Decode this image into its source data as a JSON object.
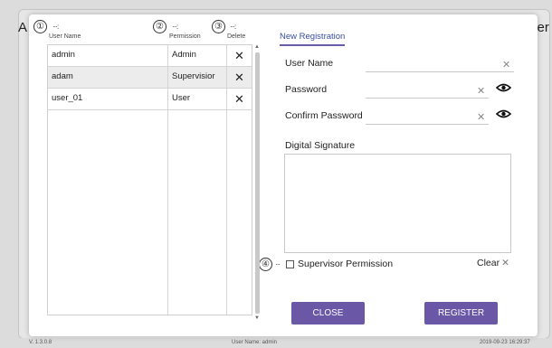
{
  "background": {
    "title_left": "A",
    "title_right": "ser",
    "status": {
      "version": "V. 1.3.0.8",
      "user": "User Name: admin",
      "datetime": "2019-09-23 16:29:37"
    }
  },
  "callouts": [
    {
      "number": "①",
      "dots": "···:"
    },
    {
      "number": "②",
      "dots": "···:"
    },
    {
      "number": "③",
      "dots": "···:"
    },
    {
      "number": "④",
      "dots": "···"
    }
  ],
  "table": {
    "headers": [
      "User Name",
      "Permission",
      "Delete"
    ],
    "rows": [
      {
        "user": "admin",
        "permission": "Admin",
        "delete": "✕"
      },
      {
        "user": "adam",
        "permission": "Supervisior",
        "delete": "✕"
      },
      {
        "user": "user_01",
        "permission": "User",
        "delete": "✕"
      }
    ]
  },
  "form": {
    "tab_label": "New Registration",
    "user_name_label": "User Name",
    "password_label": "Password",
    "confirm_password_label": "Confirm Password",
    "digital_signature_label": "Digital Signature",
    "supervisor_label": "Supervisor Permission",
    "clear_label": "Clear",
    "clear_icon": "✕",
    "input_clear_icon": "✕",
    "close_label": "CLOSE",
    "register_label": "REGISTER"
  },
  "colors": {
    "accent": "#6a58a6",
    "tab_text": "#3b4f9e"
  }
}
